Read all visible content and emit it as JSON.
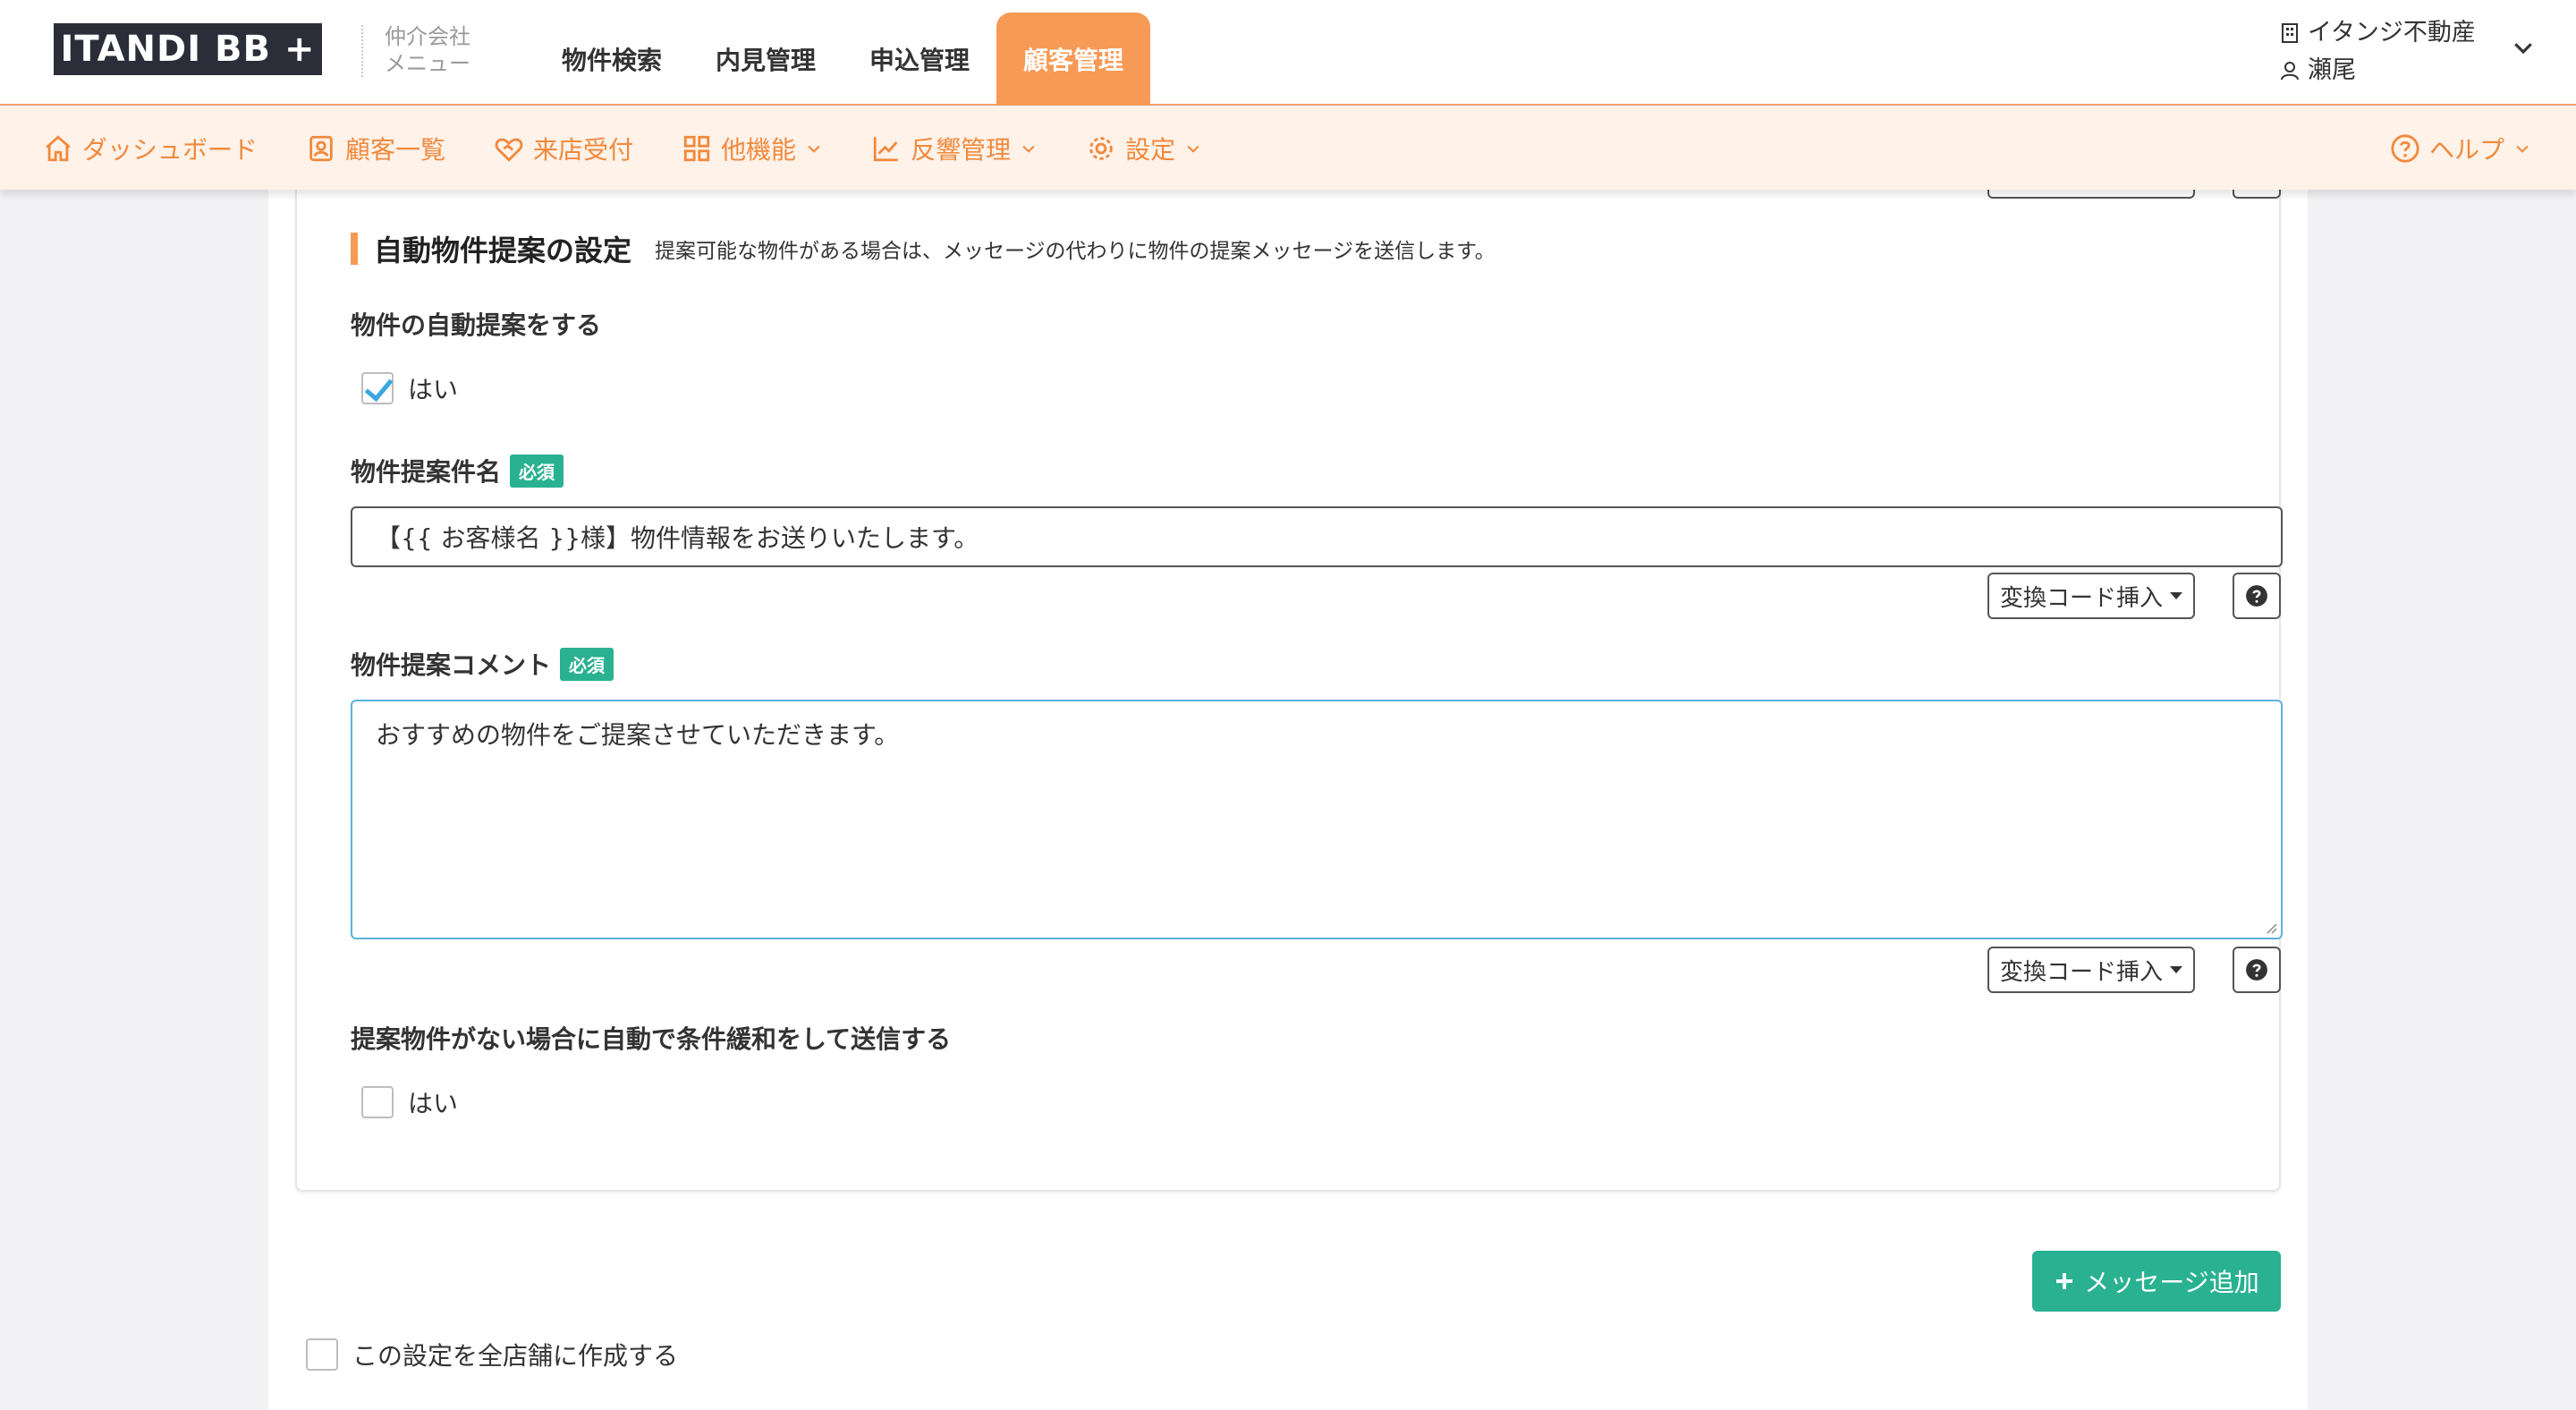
{
  "header": {
    "logo": "ITANDI BB +",
    "company_menu": [
      "仲介会社",
      "メニュー"
    ],
    "nav": [
      "物件検索",
      "内見管理",
      "申込管理",
      "顧客管理"
    ],
    "company_name": "イタンジ不動産",
    "user_name": "瀬尾"
  },
  "subnav": {
    "items": [
      "ダッシュボード",
      "顧客一覧",
      "来店受付",
      "他機能",
      "反響管理",
      "設定"
    ],
    "help": "ヘルプ"
  },
  "form": {
    "convert_button": "変換コード挿入",
    "section_title": "自動物件提案の設定",
    "section_desc": "提案可能な物件がある場合は、メッセージの代わりに物件の提案メッセージを送信します。",
    "auto_propose_label": "物件の自動提案をする",
    "yes_label": "はい",
    "subject_label": "物件提案件名",
    "required_badge": "必須",
    "subject_value": "【{{ お客様名 }}様】物件情報をお送りいたします。",
    "comment_label": "物件提案コメント",
    "comment_value": "おすすめの物件をご提案させていただきます。",
    "relax_label": "提案物件がない場合に自動で条件緩和をして送信する",
    "add_message_button": "メッセージ追加",
    "all_store_label": "この設定を全店舗に作成する"
  },
  "colors": {
    "accent_orange": "#f79a55",
    "subnav_bg": "#fff2e9",
    "required_green": "#2ab191",
    "focus_blue": "#5ab4d8"
  }
}
